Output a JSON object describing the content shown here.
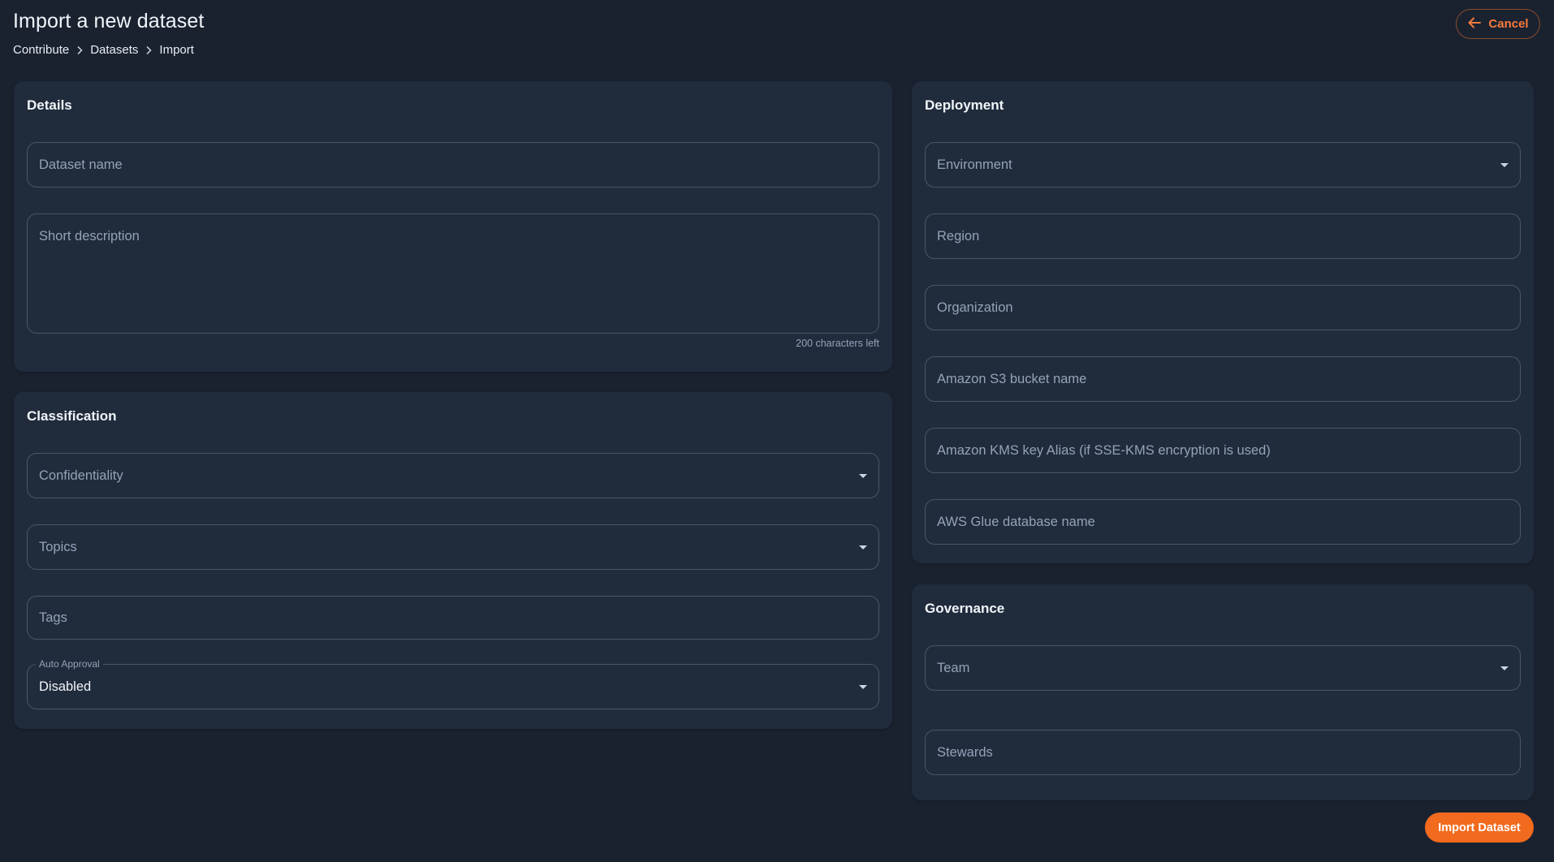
{
  "header": {
    "title": "Import a new dataset",
    "breadcrumb": [
      "Contribute",
      "Datasets",
      "Import"
    ],
    "cancel_label": "Cancel"
  },
  "details": {
    "title": "Details",
    "dataset_name_placeholder": "Dataset name",
    "short_description_placeholder": "Short description",
    "chars_left": "200 characters left"
  },
  "classification": {
    "title": "Classification",
    "confidentiality_placeholder": "Confidentiality",
    "topics_placeholder": "Topics",
    "tags_placeholder": "Tags",
    "auto_approval_label": "Auto Approval",
    "auto_approval_value": "Disabled"
  },
  "deployment": {
    "title": "Deployment",
    "environment_placeholder": "Environment",
    "region_placeholder": "Region",
    "organization_placeholder": "Organization",
    "s3_bucket_placeholder": "Amazon S3 bucket name",
    "kms_alias_placeholder": "Amazon KMS key Alias (if SSE-KMS encryption is used)",
    "glue_db_placeholder": "AWS Glue database name"
  },
  "governance": {
    "title": "Governance",
    "team_placeholder": "Team",
    "stewards_placeholder": "Stewards"
  },
  "actions": {
    "import_label": "Import Dataset"
  },
  "colors": {
    "background": "#1a2230",
    "card": "#202b3c",
    "accent": "#f26a1d"
  }
}
